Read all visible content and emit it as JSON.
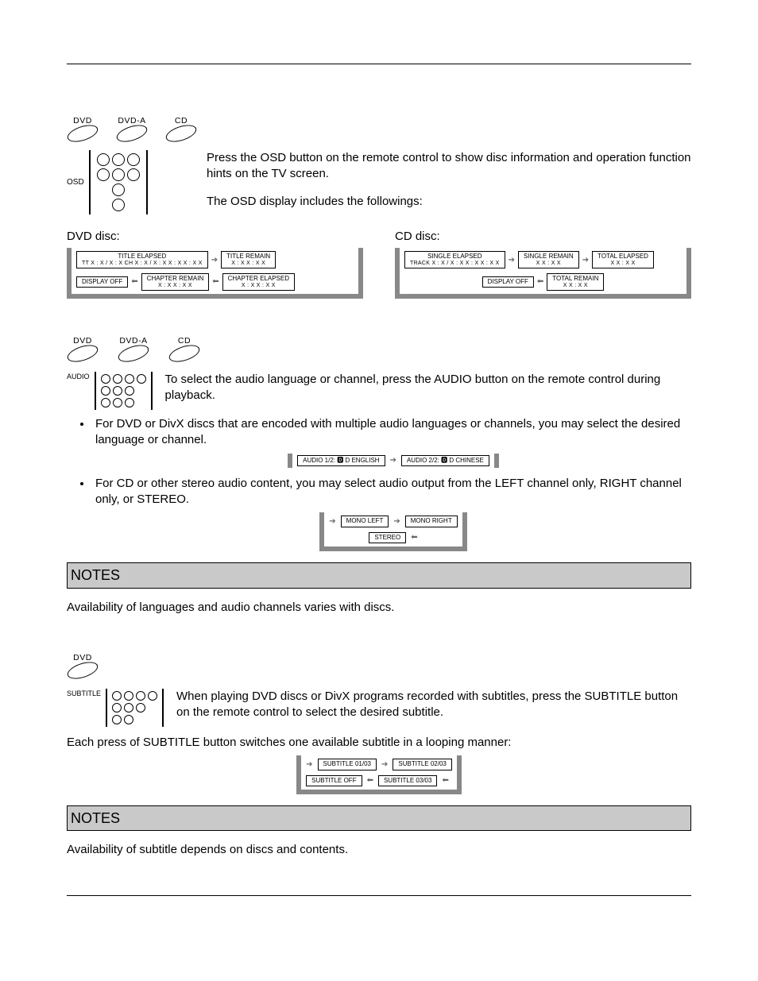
{
  "disc_labels": {
    "dvd": "DVD",
    "dvda": "DVD-A",
    "cd": "CD"
  },
  "osd": {
    "icon_label": "OSD",
    "p1": "Press the OSD button on the remote control to show disc information and operation function hints on the TV screen.",
    "p2": "The OSD display includes the followings:",
    "dvd_title": "DVD disc:",
    "cd_title": "CD disc:",
    "dvd": {
      "title_elapsed": "TITLE ELAPSED",
      "title_elapsed_sub": "TT X : X / X : X  CH X : X / X : X  X : X X : X X",
      "title_remain": "TITLE REMAIN",
      "title_remain_sub": "X : X X : X X",
      "chapter_remain": "CHAPTER REMAIN",
      "chapter_remain_sub": "X : X X : X X",
      "chapter_elapsed": "CHAPTER ELAPSED",
      "chapter_elapsed_sub": "X : X X : X X",
      "display_off": "DISPLAY OFF"
    },
    "cd": {
      "single_elapsed": "SINGLE ELAPSED",
      "single_elapsed_sub": "TRACK X : X / X : X  X : X X : X X",
      "single_remain": "SINGLE REMAIN",
      "single_remain_sub": "X X : X X",
      "total_elapsed": "TOTAL ELAPSED",
      "total_elapsed_sub": "X X : X X",
      "total_remain": "TOTAL REMAIN",
      "total_remain_sub": "X X : X X",
      "display_off": "DISPLAY OFF"
    }
  },
  "audio": {
    "icon_label": "AUDIO",
    "intro": "To select the audio language or channel, press the AUDIO button on the remote control during playback.",
    "li1": "For DVD or DivX discs that are encoded with multiple audio languages or channels, you may select the desired language or channel.",
    "li2": "For CD or other stereo audio content, you may select audio output from the LEFT channel only, RIGHT channel only, or STEREO.",
    "opt_eng": "AUDIO  1/2:  🅳 D   ENGLISH",
    "opt_chi": "AUDIO  2/2:  🅳 D   CHINESE",
    "mono_left": "MONO LEFT",
    "mono_right": "MONO RIGHT",
    "stereo": "STEREO",
    "notes_title": "NOTES",
    "notes_body": "Availability of languages and audio channels varies with discs."
  },
  "subtitle": {
    "icon_label": "SUBTITLE",
    "p1": "When playing DVD discs or DivX programs recorded with subtitles, press the SUBTITLE button on the remote control to select the desired subtitle.",
    "p2": "Each press of SUBTITLE button switches one available subtitle in a looping manner:",
    "s1": "SUBTITLE 01/03",
    "s2": "SUBTITLE 02/03",
    "s3": "SUBTITLE 03/03",
    "off": "SUBTITLE OFF",
    "notes_title": "NOTES",
    "notes_body": "Availability of subtitle depends on discs and contents."
  }
}
